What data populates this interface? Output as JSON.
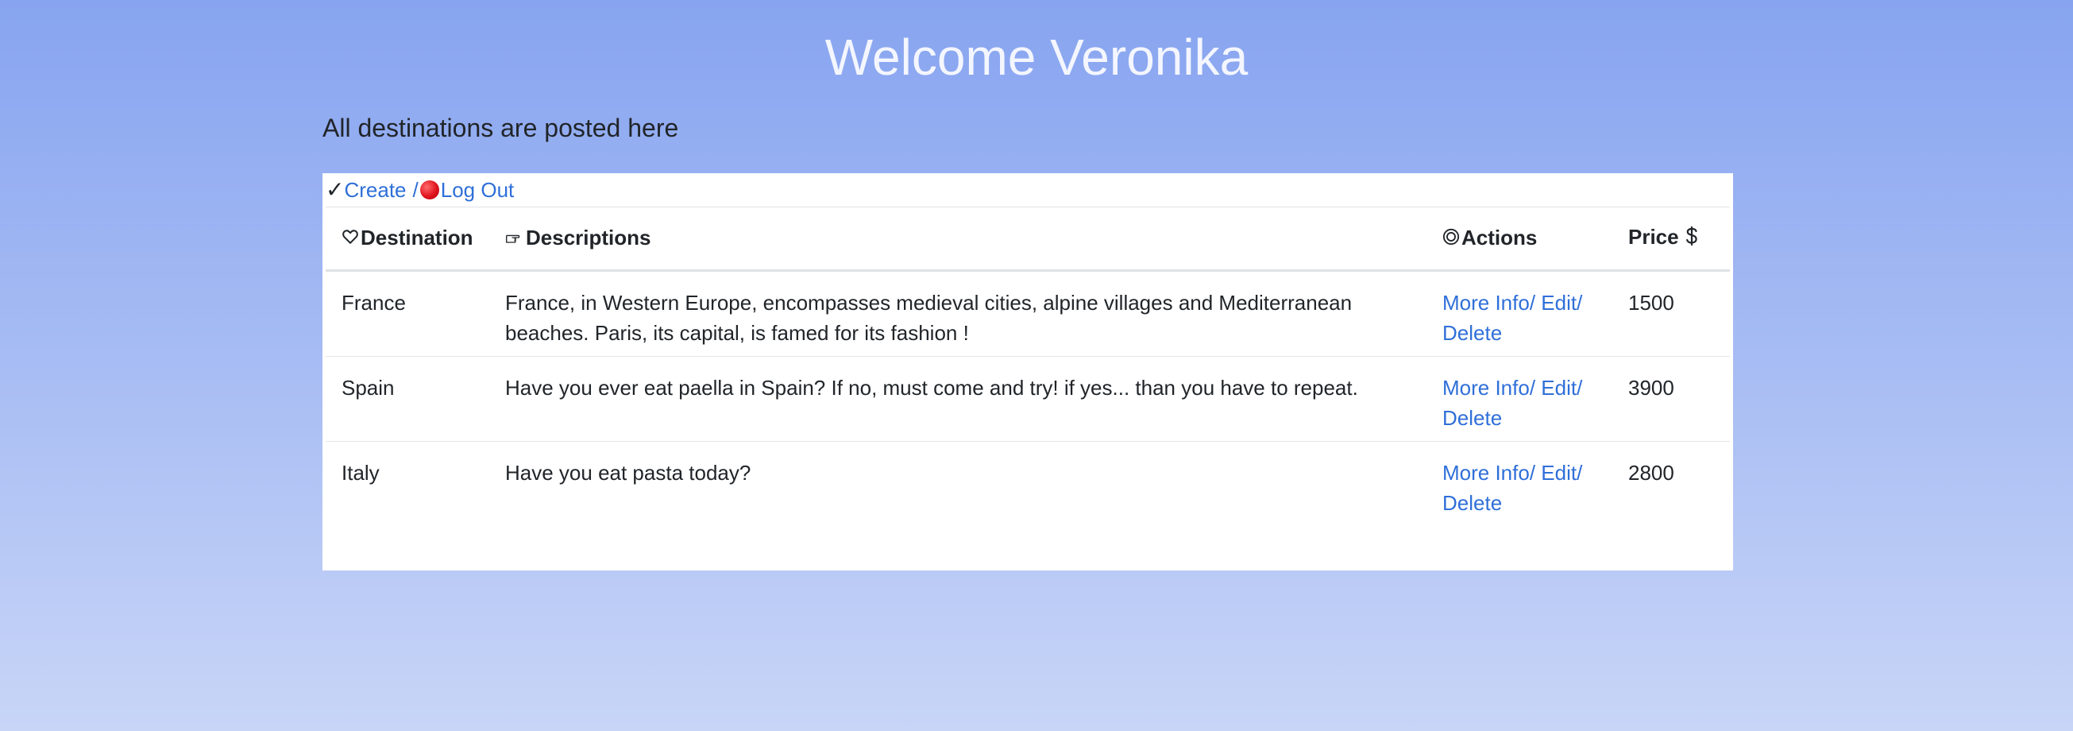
{
  "header": {
    "title": "Welcome Veronika",
    "subtitle": "All destinations are posted here"
  },
  "toolbar": {
    "check_glyph": "✓",
    "create_label": "Create",
    "separator": "/",
    "logout_label": "Log Out"
  },
  "table": {
    "columns": {
      "destination": "Destination",
      "descriptions": "Descriptions",
      "actions": "Actions",
      "price": "Price"
    },
    "rows": [
      {
        "destination": "France",
        "description": "France, in Western Europe, encompasses medieval cities, alpine villages and Mediterranean beaches. Paris, its capital, is famed for its fashion !",
        "actions": {
          "more_info": "More Info/",
          "edit": "Edit/",
          "delete": "Delete"
        },
        "price": "1500"
      },
      {
        "destination": "Spain",
        "description": "Have you ever eat paella in Spain? If no, must come and try! if yes... than you have to repeat.",
        "actions": {
          "more_info": "More Info/",
          "edit": "Edit/",
          "delete": "Delete"
        },
        "price": "3900"
      },
      {
        "destination": "Italy",
        "description": "Have you eat pasta today?",
        "actions": {
          "more_info": "More Info/",
          "edit": "Edit/",
          "delete": "Delete"
        },
        "price": "2800"
      }
    ]
  },
  "icons": {
    "destination_header": "heart-outline-icon",
    "descriptions_header": "pointing-hand-icon",
    "actions_header": "target-icon",
    "price_header": "dollar-icon",
    "logout": "red-circle-icon",
    "create": "check-icon"
  },
  "colors": {
    "background_top": "#87a4f0",
    "background_bottom": "#c8d5f7",
    "link": "#2f6fd8",
    "title": "#f4f6ff"
  }
}
